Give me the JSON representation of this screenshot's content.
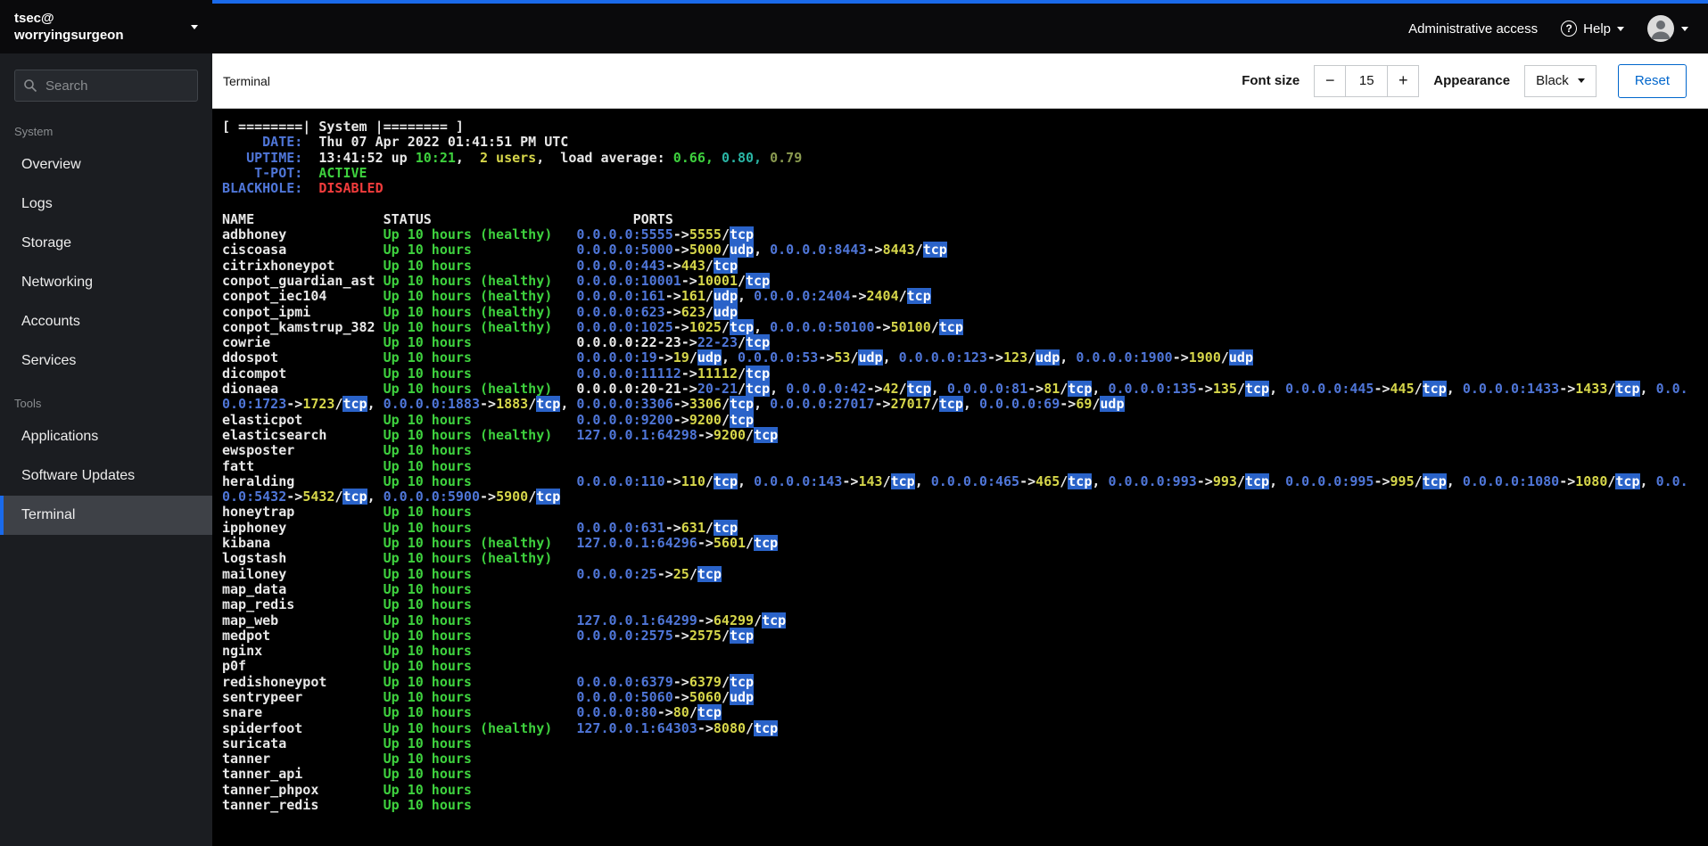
{
  "colors": {
    "accent": "#1a6aeb",
    "link": "#0066cc",
    "term_green": "#3ed13e",
    "term_yellow": "#d6d64a",
    "term_blue": "#4f76d8",
    "term_red": "#f23c3c",
    "term_teal": "#2ab5a5",
    "term_olive": "#8a9a50",
    "highlight_bg": "#2a63c9"
  },
  "sidebar": {
    "user_line1": "tsec@",
    "user_line2": "worryingsurgeon",
    "search_placeholder": "Search",
    "active_item": "Terminal",
    "sections": [
      {
        "label": "System",
        "items": [
          "Overview",
          "Logs",
          "Storage",
          "Networking",
          "Accounts",
          "Services"
        ]
      },
      {
        "label": "Tools",
        "items": [
          "Applications",
          "Software Updates",
          "Terminal"
        ]
      }
    ]
  },
  "topbar": {
    "admin_label": "Administrative access",
    "help_label": "Help"
  },
  "toolbar": {
    "title": "Terminal",
    "font_size_label": "Font size",
    "decrease_label": "−",
    "font_size_value": "15",
    "increase_label": "+",
    "appearance_label": "Appearance",
    "appearance_value": "Black",
    "reset_label": "Reset"
  },
  "terminal": {
    "banner_title": "[ ========| System |======== ]",
    "info": [
      {
        "label": "DATE:",
        "segments": [
          {
            "text": "Thu 07 Apr 2022 01:41:51 PM UTC",
            "color": "white"
          }
        ]
      },
      {
        "label": "UPTIME:",
        "segments": [
          {
            "text": "13:41:52 up ",
            "color": "white"
          },
          {
            "text": "10:21",
            "color": "green"
          },
          {
            "text": ",  ",
            "color": "white"
          },
          {
            "text": "2 users",
            "color": "yellow"
          },
          {
            "text": ",  load average: ",
            "color": "white"
          },
          {
            "text": "0.66,",
            "color": "green"
          },
          {
            "text": " ",
            "color": "white"
          },
          {
            "text": "0.80,",
            "color": "teal"
          },
          {
            "text": " ",
            "color": "white"
          },
          {
            "text": "0.79",
            "color": "olive"
          }
        ]
      },
      {
        "label": "T-POT:",
        "segments": [
          {
            "text": "ACTIVE",
            "color": "green"
          }
        ]
      },
      {
        "label": "BLACKHOLE:",
        "segments": [
          {
            "text": "DISABLED",
            "color": "red"
          }
        ]
      }
    ],
    "columns": [
      "NAME",
      "STATUS",
      "PORTS"
    ],
    "containers": [
      {
        "name": "adbhoney",
        "status": "Up 10 hours (healthy)",
        "ports": "0.0.0.0:5555->5555/tcp"
      },
      {
        "name": "ciscoasa",
        "status": "Up 10 hours",
        "ports": "0.0.0.0:5000->5000/udp, 0.0.0.0:8443->8443/tcp"
      },
      {
        "name": "citrixhoneypot",
        "status": "Up 10 hours",
        "ports": "0.0.0.0:443->443/tcp"
      },
      {
        "name": "conpot_guardian_ast",
        "status": "Up 10 hours (healthy)",
        "ports": "0.0.0.0:10001->10001/tcp"
      },
      {
        "name": "conpot_iec104",
        "status": "Up 10 hours (healthy)",
        "ports": "0.0.0.0:161->161/udp, 0.0.0.0:2404->2404/tcp"
      },
      {
        "name": "conpot_ipmi",
        "status": "Up 10 hours (healthy)",
        "ports": "0.0.0.0:623->623/udp"
      },
      {
        "name": "conpot_kamstrup_382",
        "status": "Up 10 hours (healthy)",
        "ports": "0.0.0.0:1025->1025/tcp, 0.0.0.0:50100->50100/tcp"
      },
      {
        "name": "cowrie",
        "status": "Up 10 hours",
        "ports": "0.0.0.0:22-23->22-23/tcp"
      },
      {
        "name": "ddospot",
        "status": "Up 10 hours",
        "ports": "0.0.0.0:19->19/udp, 0.0.0.0:53->53/udp, 0.0.0.0:123->123/udp, 0.0.0.0:1900->1900/udp"
      },
      {
        "name": "dicompot",
        "status": "Up 10 hours",
        "ports": "0.0.0.0:11112->11112/tcp"
      },
      {
        "name": "dionaea",
        "status": "Up 10 hours (healthy)",
        "ports": "0.0.0.0:20-21->20-21/tcp, 0.0.0.0:42->42/tcp, 0.0.0.0:81->81/tcp, 0.0.0.0:135->135/tcp, 0.0.0.0:445->445/tcp, 0.0.0.0:1433->1433/tcp, 0.0.0.0:1723->1723/tcp, 0.0.0.0:1883->1883/tcp, 0.0.0.0:3306->3306/tcp, 0.0.0.0:27017->27017/tcp, 0.0.0.0:69->69/udp"
      },
      {
        "name": "elasticpot",
        "status": "Up 10 hours",
        "ports": "0.0.0.0:9200->9200/tcp"
      },
      {
        "name": "elasticsearch",
        "status": "Up 10 hours (healthy)",
        "ports": "127.0.0.1:64298->9200/tcp"
      },
      {
        "name": "ewsposter",
        "status": "Up 10 hours",
        "ports": ""
      },
      {
        "name": "fatt",
        "status": "Up 10 hours",
        "ports": ""
      },
      {
        "name": "heralding",
        "status": "Up 10 hours",
        "ports": "0.0.0.0:110->110/tcp, 0.0.0.0:143->143/tcp, 0.0.0.0:465->465/tcp, 0.0.0.0:993->993/tcp, 0.0.0.0:995->995/tcp, 0.0.0.0:1080->1080/tcp, 0.0.0.0:5432->5432/tcp, 0.0.0.0:5900->5900/tcp"
      },
      {
        "name": "honeytrap",
        "status": "Up 10 hours",
        "ports": ""
      },
      {
        "name": "ipphoney",
        "status": "Up 10 hours",
        "ports": "0.0.0.0:631->631/tcp"
      },
      {
        "name": "kibana",
        "status": "Up 10 hours (healthy)",
        "ports": "127.0.0.1:64296->5601/tcp"
      },
      {
        "name": "logstash",
        "status": "Up 10 hours (healthy)",
        "ports": ""
      },
      {
        "name": "mailoney",
        "status": "Up 10 hours",
        "ports": "0.0.0.0:25->25/tcp"
      },
      {
        "name": "map_data",
        "status": "Up 10 hours",
        "ports": ""
      },
      {
        "name": "map_redis",
        "status": "Up 10 hours",
        "ports": ""
      },
      {
        "name": "map_web",
        "status": "Up 10 hours",
        "ports": "127.0.0.1:64299->64299/tcp"
      },
      {
        "name": "medpot",
        "status": "Up 10 hours",
        "ports": "0.0.0.0:2575->2575/tcp"
      },
      {
        "name": "nginx",
        "status": "Up 10 hours",
        "ports": ""
      },
      {
        "name": "p0f",
        "status": "Up 10 hours",
        "ports": ""
      },
      {
        "name": "redishoneypot",
        "status": "Up 10 hours",
        "ports": "0.0.0.0:6379->6379/tcp"
      },
      {
        "name": "sentrypeer",
        "status": "Up 10 hours",
        "ports": "0.0.0.0:5060->5060/udp"
      },
      {
        "name": "snare",
        "status": "Up 10 hours",
        "ports": "0.0.0.0:80->80/tcp"
      },
      {
        "name": "spiderfoot",
        "status": "Up 10 hours (healthy)",
        "ports": "127.0.0.1:64303->8080/tcp"
      },
      {
        "name": "suricata",
        "status": "Up 10 hours",
        "ports": ""
      },
      {
        "name": "tanner",
        "status": "Up 10 hours",
        "ports": ""
      },
      {
        "name": "tanner_api",
        "status": "Up 10 hours",
        "ports": ""
      },
      {
        "name": "tanner_phpox",
        "status": "Up 10 hours",
        "ports": ""
      },
      {
        "name": "tanner_redis",
        "status": "Up 10 hours",
        "ports": ""
      }
    ]
  }
}
